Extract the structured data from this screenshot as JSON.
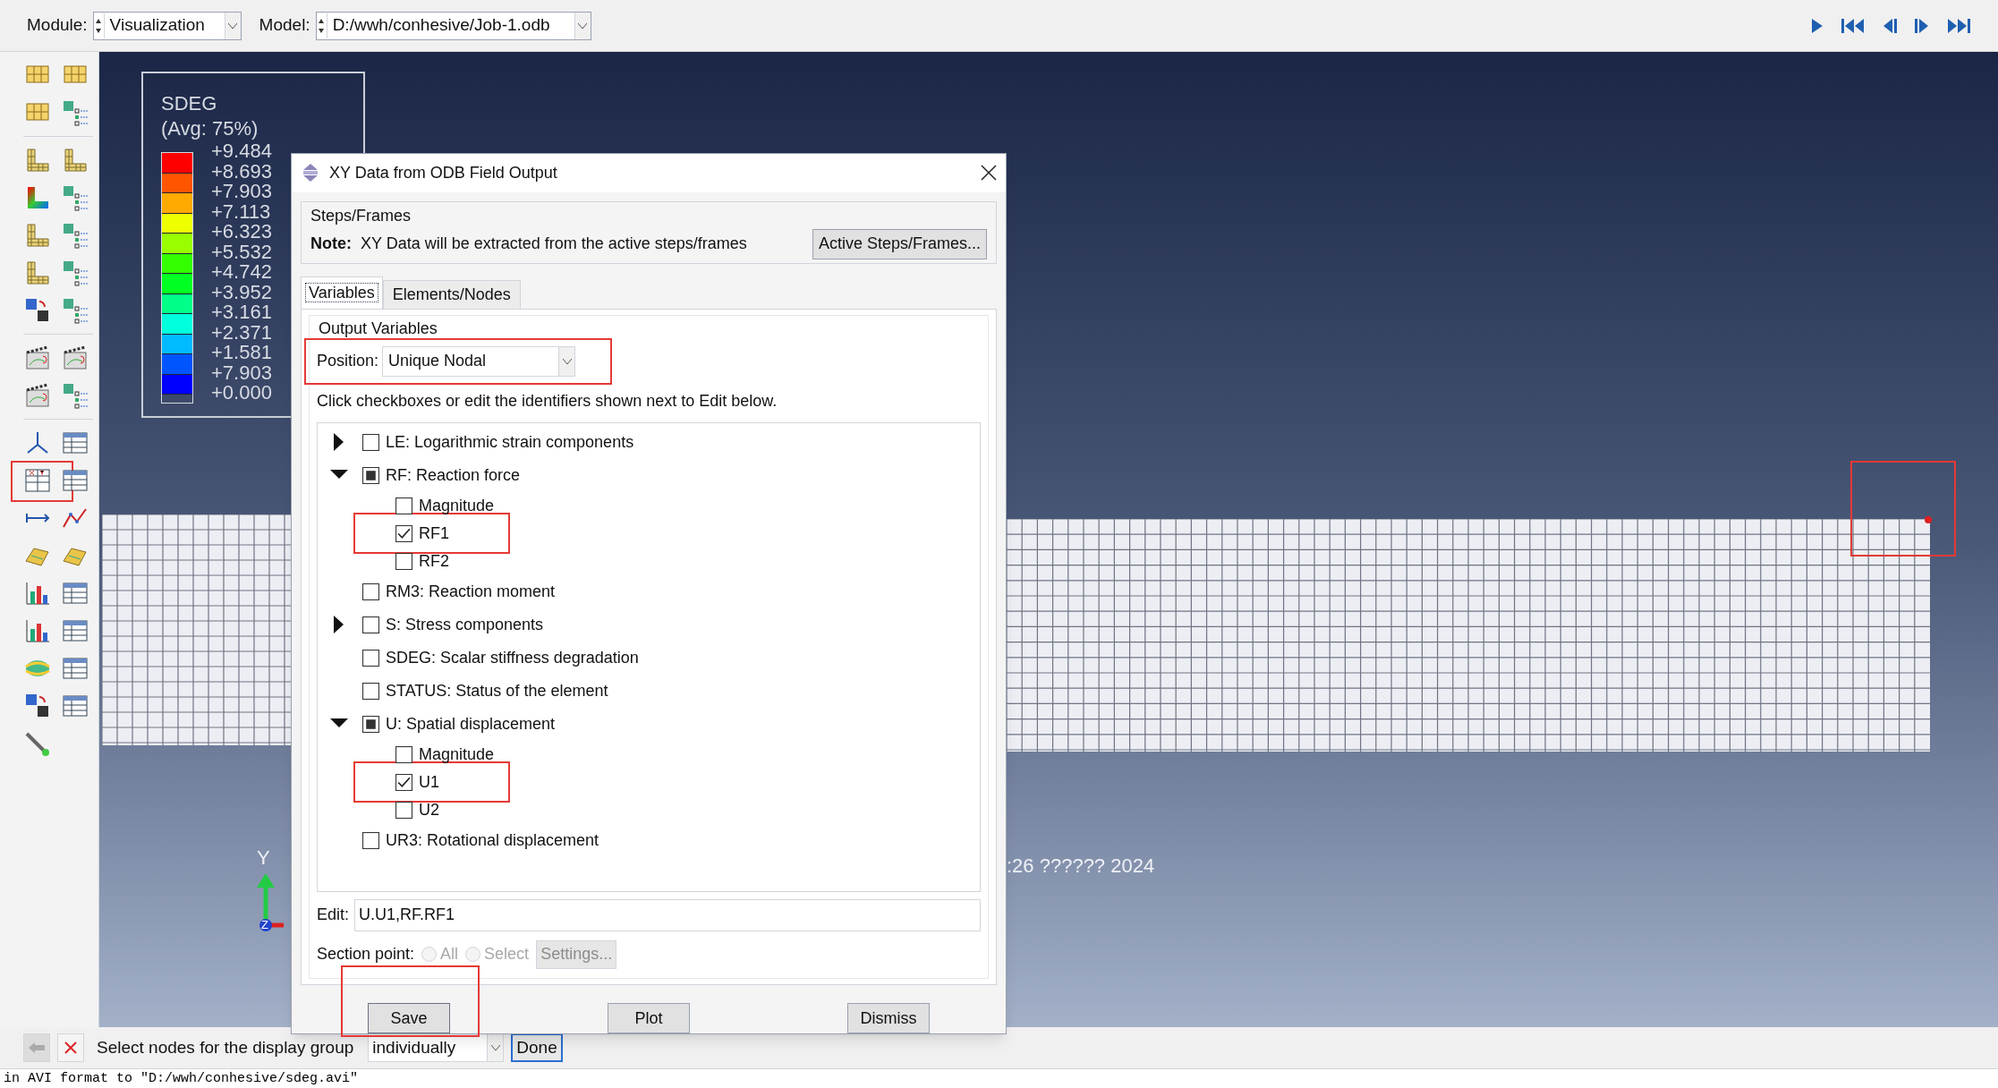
{
  "toolbar": {
    "module_label": "Module:",
    "module": "Visualization",
    "model_label": "Model:",
    "model": "D:/wwh/conhesive/Job-1.odb"
  },
  "left_toolbar": {
    "xy_tool": {
      "highlighted": true
    }
  },
  "legend": {
    "title": "SDEG",
    "subtitle": "(Avg: 75%)",
    "bands": [
      {
        "color": "#ff0000"
      },
      {
        "color": "#ff5500"
      },
      {
        "color": "#ffaa00"
      },
      {
        "color": "#eeff00"
      },
      {
        "color": "#99ff00"
      },
      {
        "color": "#33ff00"
      },
      {
        "color": "#00ff22"
      },
      {
        "color": "#00ff88"
      },
      {
        "color": "#00ffdd"
      },
      {
        "color": "#00bbff"
      },
      {
        "color": "#0055ff"
      },
      {
        "color": "#0000ff"
      }
    ],
    "labels": [
      "+9.484",
      "+8.693",
      "+7.903",
      "+7.113",
      "+6.323",
      "+5.532",
      "+4.742",
      "+3.952",
      "+3.161",
      "+2.371",
      "+1.581",
      "+7.903",
      "+0.000"
    ]
  },
  "viewport": {
    "stamp": ":26 ?????? 2024",
    "triad": {
      "y_label": "Y",
      "z_label": "Z"
    },
    "node_marker": {
      "highlighted": true
    }
  },
  "dialog": {
    "title": "XY Data from ODB Field Output",
    "steps_group": "Steps/Frames",
    "note_label": "Note:",
    "note": "XY Data will be extracted from the active steps/frames",
    "active_button": "Active Steps/Frames...",
    "tabs": [
      {
        "label": "Variables",
        "selected": true
      },
      {
        "label": "Elements/Nodes",
        "selected": false
      }
    ],
    "output_group": "Output Variables",
    "position_label": "Position:",
    "position": "Unique Nodal",
    "position_highlighted": true,
    "hint": "Click checkboxes or edit the identifiers shown next to Edit below.",
    "variables": [
      {
        "label": "LE: Logarithmic strain components",
        "kind": "group",
        "expanded": false,
        "checked": false,
        "partial": false
      },
      {
        "label": "RF: Reaction force",
        "kind": "group",
        "expanded": true,
        "checked": false,
        "partial": true,
        "children": [
          {
            "label": "Magnitude",
            "checked": false,
            "highlighted": false
          },
          {
            "label": "RF1",
            "checked": true,
            "highlighted": true
          },
          {
            "label": "RF2",
            "checked": false,
            "highlighted": false
          }
        ]
      },
      {
        "label": "RM3: Reaction moment",
        "kind": "leaf",
        "checked": false,
        "partial": false
      },
      {
        "label": "S: Stress components",
        "kind": "group",
        "expanded": false,
        "checked": false,
        "partial": false
      },
      {
        "label": "SDEG: Scalar stiffness degradation",
        "kind": "leaf",
        "checked": false,
        "partial": false
      },
      {
        "label": "STATUS: Status of the element",
        "kind": "leaf",
        "checked": false,
        "partial": false
      },
      {
        "label": "U: Spatial displacement",
        "kind": "group",
        "expanded": true,
        "checked": false,
        "partial": true,
        "children": [
          {
            "label": "Magnitude",
            "checked": false,
            "highlighted": false
          },
          {
            "label": "U1",
            "checked": true,
            "highlighted": true
          },
          {
            "label": "U2",
            "checked": false,
            "highlighted": false
          }
        ]
      },
      {
        "label": "UR3: Rotational displacement",
        "kind": "leaf",
        "checked": false,
        "partial": false
      }
    ],
    "edit_label": "Edit:",
    "edit_value": "U.U1,RF.RF1",
    "section_label": "Section point:",
    "section_options": [
      {
        "label": "All",
        "selected": false,
        "disabled": true
      },
      {
        "label": "Select",
        "selected": false,
        "disabled": true
      }
    ],
    "settings_button": {
      "label": "Settings...",
      "disabled": true
    },
    "buttons": [
      {
        "label": "Save",
        "highlighted": true
      },
      {
        "label": "Plot",
        "highlighted": false
      },
      {
        "label": "Dismiss",
        "highlighted": false
      }
    ]
  },
  "prompt": {
    "text": "Select nodes for the display group",
    "method": "individually",
    "done": "Done"
  },
  "message": "in AVI format to \"D:/wwh/conhesive/sdeg.avi\""
}
